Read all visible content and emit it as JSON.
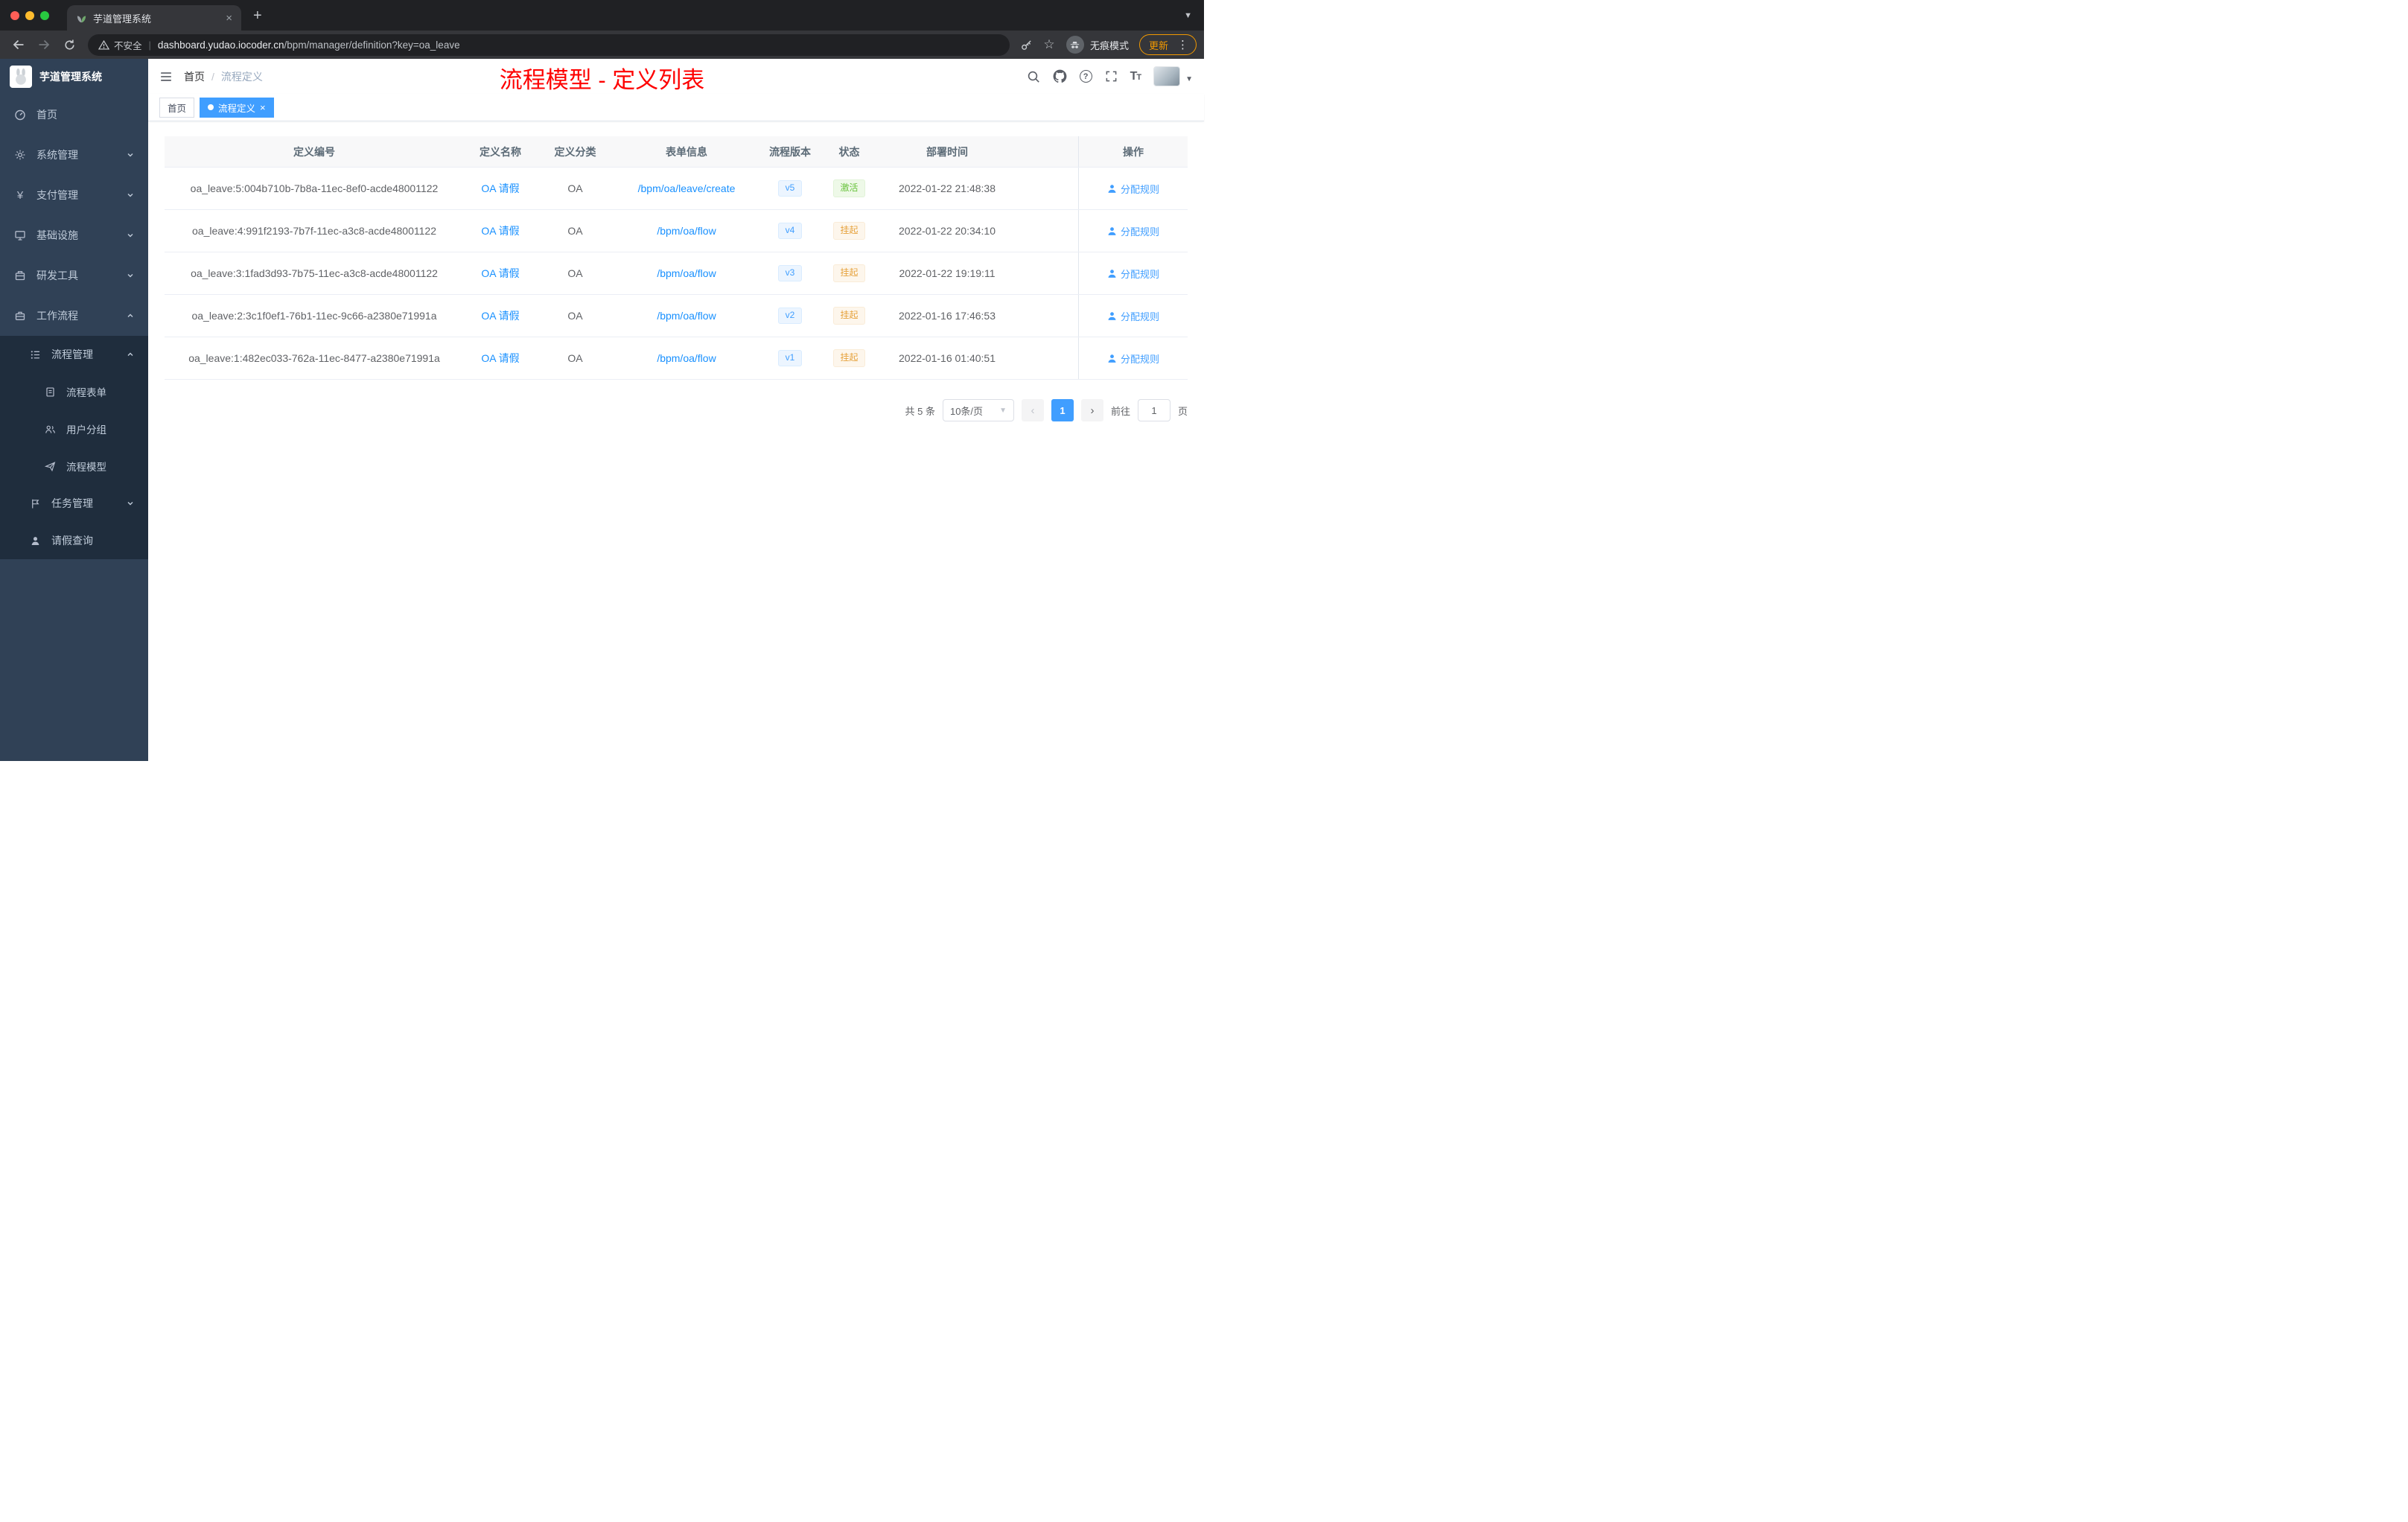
{
  "browser": {
    "tab_title": "芋道管理系统",
    "not_secure": "不安全",
    "url_host": "dashboard.yudao.iocoder.cn",
    "url_path": "/bpm/manager/definition?key=oa_leave",
    "incognito_label": "无痕模式",
    "update_label": "更新"
  },
  "sidebar": {
    "app_title": "芋道管理系统",
    "home": "首页",
    "system": "系统管理",
    "payment": "支付管理",
    "infra": "基础设施",
    "devtools": "研发工具",
    "workflow": "工作流程",
    "process_mgmt": "流程管理",
    "process_form": "流程表单",
    "user_group": "用户分组",
    "process_model": "流程模型",
    "task_mgmt": "任务管理",
    "leave_query": "请假查询"
  },
  "header": {
    "breadcrumb_home": "首页",
    "breadcrumb_sep": "/",
    "breadcrumb_current": "流程定义",
    "annotation": "流程模型 - 定义列表"
  },
  "tags": {
    "home": "首页",
    "active": "流程定义"
  },
  "table": {
    "headers": [
      "定义编号",
      "定义名称",
      "定义分类",
      "表单信息",
      "流程版本",
      "状态",
      "部署时间",
      "操作"
    ],
    "action_label": "分配规则",
    "rows": [
      {
        "id": "oa_leave:5:004b710b-7b8a-11ec-8ef0-acde48001122",
        "name": "OA 请假",
        "category": "OA",
        "form": "/bpm/oa/leave/create",
        "version": "v5",
        "status": "激活",
        "time": "2022-01-22 21:48:38"
      },
      {
        "id": "oa_leave:4:991f2193-7b7f-11ec-a3c8-acde48001122",
        "name": "OA 请假",
        "category": "OA",
        "form": "/bpm/oa/flow",
        "version": "v4",
        "status": "挂起",
        "time": "2022-01-22 20:34:10"
      },
      {
        "id": "oa_leave:3:1fad3d93-7b75-11ec-a3c8-acde48001122",
        "name": "OA 请假",
        "category": "OA",
        "form": "/bpm/oa/flow",
        "version": "v3",
        "status": "挂起",
        "time": "2022-01-22 19:19:11"
      },
      {
        "id": "oa_leave:2:3c1f0ef1-76b1-11ec-9c66-a2380e71991a",
        "name": "OA 请假",
        "category": "OA",
        "form": "/bpm/oa/flow",
        "version": "v2",
        "status": "挂起",
        "time": "2022-01-16 17:46:53"
      },
      {
        "id": "oa_leave:1:482ec033-762a-11ec-8477-a2380e71991a",
        "name": "OA 请假",
        "category": "OA",
        "form": "/bpm/oa/flow",
        "version": "v1",
        "status": "挂起",
        "time": "2022-01-16 01:40:51"
      }
    ]
  },
  "pagination": {
    "total": "共 5 条",
    "page_size": "10条/页",
    "page": "1",
    "jump_prefix": "前往",
    "jump_value": "1",
    "jump_suffix": "页"
  },
  "colors": {
    "accent_blue": "#409eff",
    "success_green": "#67c23a",
    "warning_orange": "#e6a23c",
    "annotation_red": "#fe0100",
    "sidebar_bg": "#304156",
    "submenu_bg": "#1f2d3d"
  }
}
